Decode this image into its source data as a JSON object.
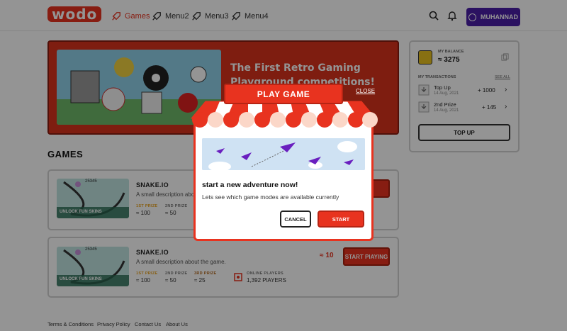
{
  "brand": {
    "logo_text": "wodo"
  },
  "nav": {
    "items": [
      {
        "label": "Games",
        "icon": "rocket-icon",
        "active": true
      },
      {
        "label": "Menu2",
        "icon": "rocket-icon"
      },
      {
        "label": "Menu3",
        "icon": "rocket-icon"
      },
      {
        "label": "Menu4",
        "icon": "rocket-icon"
      }
    ]
  },
  "header": {
    "user_label": "MUHANNAD",
    "search_icon": "search-icon",
    "bell_icon": "bell-icon"
  },
  "hero": {
    "title": "The First Retro Gaming Playground competitions!"
  },
  "games": {
    "title": "GAMES",
    "list": [
      {
        "thumb_score": "25345",
        "thumb_caption": "UNLOCK FUN SKINS",
        "name": "SNAKE.IO",
        "desc": "A small description about the game.",
        "prize1_label": "1ST PRIZE",
        "prize1_value": "100",
        "prize2_label": "2ND PRIZE",
        "prize2_value": "50",
        "play_label": "START PLAYING"
      },
      {
        "thumb_score": "25345",
        "thumb_caption": "UNLOCK FUN SKINS",
        "name": "SNAKE.IO",
        "desc": "A small description about the game.",
        "prize1_label": "1ST PRIZE",
        "prize1_value": "100",
        "prize2_label": "2ND PRIZE",
        "prize2_value": "50",
        "prize3_label": "3RD PRIZE",
        "prize3_value": "25",
        "online_label": "ONLINE PLAYERS",
        "online_value": "1,392 PlAYERS",
        "cost": "10",
        "play_label": "START PlAYING"
      }
    ]
  },
  "wallet": {
    "balance_label": "MY BALANCE",
    "balance_value": "3275",
    "tx_title": "MY TRANSACTIONS",
    "see_all": "SEE ALL",
    "transactions": [
      {
        "title": "Top Up",
        "date": "14 Aug, 2021",
        "amount": "+ 1000"
      },
      {
        "title": "2nd Prize",
        "date": "14 Aug, 2021",
        "amount": "+ 145"
      }
    ],
    "topup_label": "TOP UP"
  },
  "footer": {
    "links": [
      "Terms & Conditions",
      "Privacy Policy",
      "Contact Us",
      "About Us"
    ]
  },
  "modal": {
    "header": "PLAY GAME",
    "close": "CLOSE",
    "title": "start a new adventure now!",
    "desc": "Lets see which game modes are available currently",
    "cancel": "CANCEL",
    "start": "START"
  },
  "colors": {
    "accent": "#e8331f",
    "purple": "#4b1fa8",
    "overlay": "#000000"
  }
}
